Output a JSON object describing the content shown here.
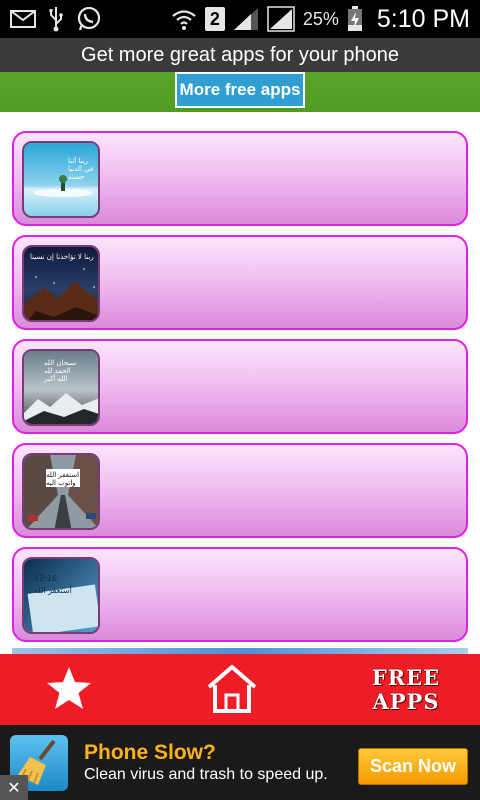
{
  "status_bar": {
    "icons_left": [
      "mail-icon",
      "usb-icon",
      "whatsapp-icon"
    ],
    "icons_right": [
      "wifi-icon",
      "sim-2-badge",
      "signal-icon",
      "signal-icon",
      "battery-charging-icon"
    ],
    "sim_slot": "2",
    "battery_percent": "25%",
    "time": "5:10 PM"
  },
  "promo": {
    "text": "Get more great apps for your phone",
    "button_label": "More free apps"
  },
  "list": {
    "items": [
      {
        "thumb_text": "ربنا آتنا\nفي الدنيا حسنة",
        "scene": "winter-sky"
      },
      {
        "thumb_text": "ربنا لا تؤاخذنا إن نسينا",
        "scene": "night-mountains"
      },
      {
        "thumb_text": "سبحان الله\nالحمد لله\nالله أكبر",
        "scene": "snowy-mountains"
      },
      {
        "thumb_text": "استغفر الله\nواتوب اليه",
        "scene": "city-street"
      },
      {
        "thumb_text": "12:16\nأستغفر الله",
        "scene": "blue-phone"
      }
    ]
  },
  "bottom_nav": {
    "favorites_icon": "star-icon",
    "home_icon": "home-icon",
    "free_apps_label_line1": "FREE",
    "free_apps_label_line2": "APPS"
  },
  "ad": {
    "icon": "broom-icon",
    "title": "Phone Slow?",
    "subtitle": "Clean virus and trash to speed up.",
    "button_label": "Scan Now",
    "close_icon": "close-icon"
  },
  "colors": {
    "card_border": "#e020e6",
    "nav_bg": "#ee1c24",
    "promo_button": "#2f9ed0",
    "ad_title": "#ffb11a"
  }
}
